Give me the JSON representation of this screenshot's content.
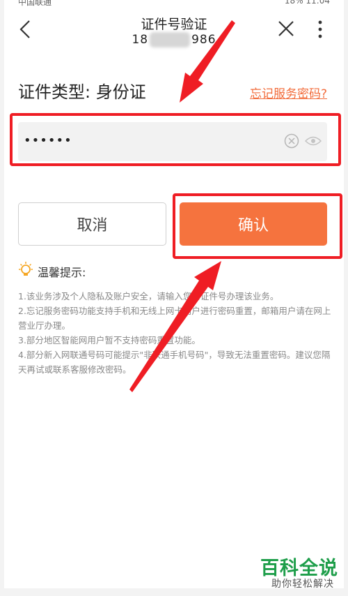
{
  "status_bar": {
    "left": "中国联通",
    "right": "18%  11:04"
  },
  "header": {
    "title": "证件号验证",
    "phone_prefix": "18",
    "phone_suffix": "986"
  },
  "form": {
    "id_type_label": "证件类型: 身份证",
    "forgot_link": "忘记服务密码?",
    "password_value": "••••••"
  },
  "buttons": {
    "cancel": "取消",
    "confirm": "确认"
  },
  "tips": {
    "heading": "温馨提示:",
    "items": [
      "1.该业务涉及个人隐私及账户安全，请输入您的证件号办理该业务。",
      "2.忘记服务密码功能支持手机和无线上网卡用户进行密码重置，邮箱用户请在网上营业厅办理。",
      "3.部分地区智能网用户暂不支持密码重置功能。",
      "4.部分新入网联通号码可能提示\"非联通手机号码\"，导致无法重置密码。建议您隔天再试或联系客服修改密码。"
    ]
  },
  "watermark": {
    "title": "百科全说",
    "subtitle": "助你轻松解决"
  },
  "colors": {
    "accent": "#f5733e",
    "annotation_red": "#ef1d24",
    "watermark_green": "#1e9e4a"
  }
}
